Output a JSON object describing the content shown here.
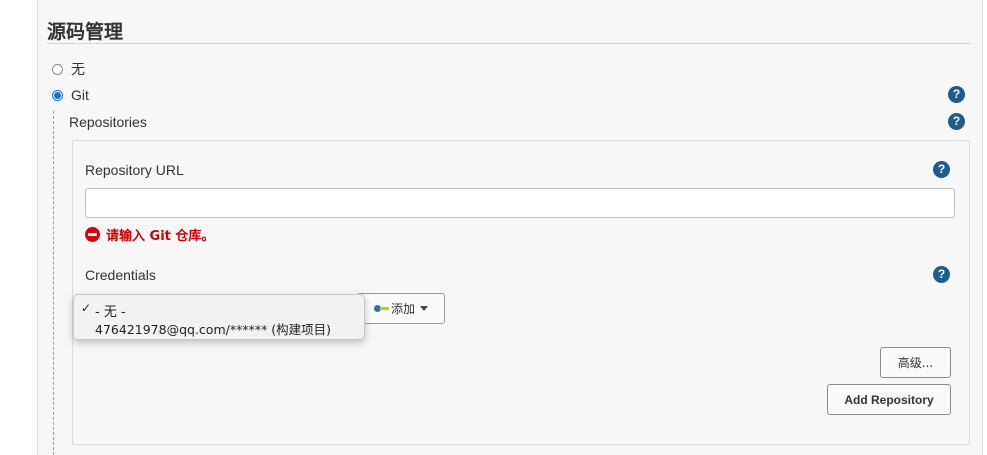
{
  "section": {
    "title": "源码管理"
  },
  "scm": {
    "options": [
      {
        "label": "无",
        "selected": false
      },
      {
        "label": "Git",
        "selected": true
      }
    ]
  },
  "repositories": {
    "label": "Repositories",
    "url": {
      "label": "Repository URL",
      "value": "",
      "error": "请输入 Git 仓库。"
    },
    "credentials": {
      "label": "Credentials",
      "dropdown_options": [
        {
          "label": "- 无 -",
          "checked": true
        },
        {
          "label": "476421978@qq.com/****** (构建项目)",
          "checked": false
        }
      ],
      "add_button": {
        "label": "添加"
      }
    },
    "advanced_button": {
      "label": "高级..."
    },
    "add_repository_button": {
      "label": "Add Repository"
    }
  },
  "help_icon": {
    "glyph": "?"
  },
  "colors": {
    "help": "#1d5d8f",
    "error": "#cc0000",
    "radio_selected": "#1a6fe0"
  }
}
